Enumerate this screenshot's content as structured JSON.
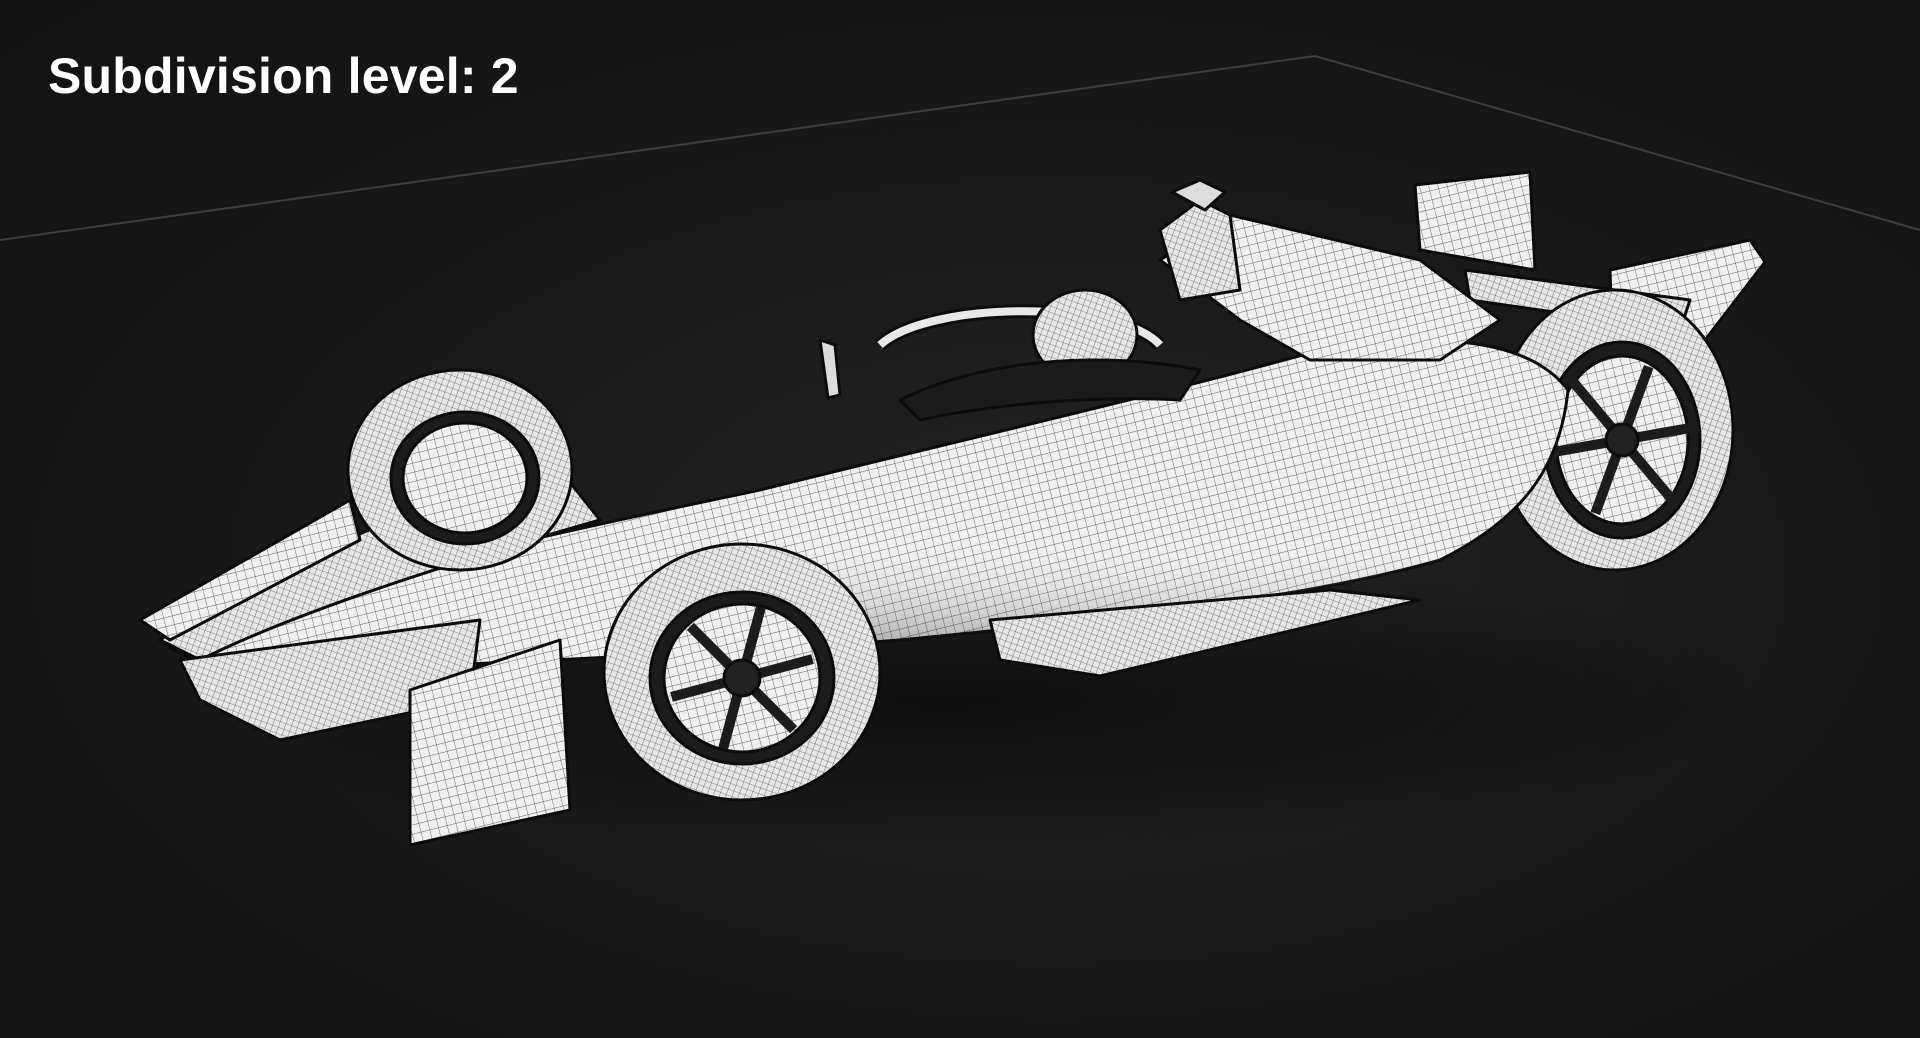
{
  "viewport": {
    "overlay_label": "Subdivision level: 2",
    "display_mode": "wireframe-on-shaded",
    "colors": {
      "background": "#141414",
      "model_surface": "#f2f2f2",
      "wire": "#2a2a2a",
      "ground_line": "#3a3a3a",
      "label": "#ffffff"
    }
  }
}
